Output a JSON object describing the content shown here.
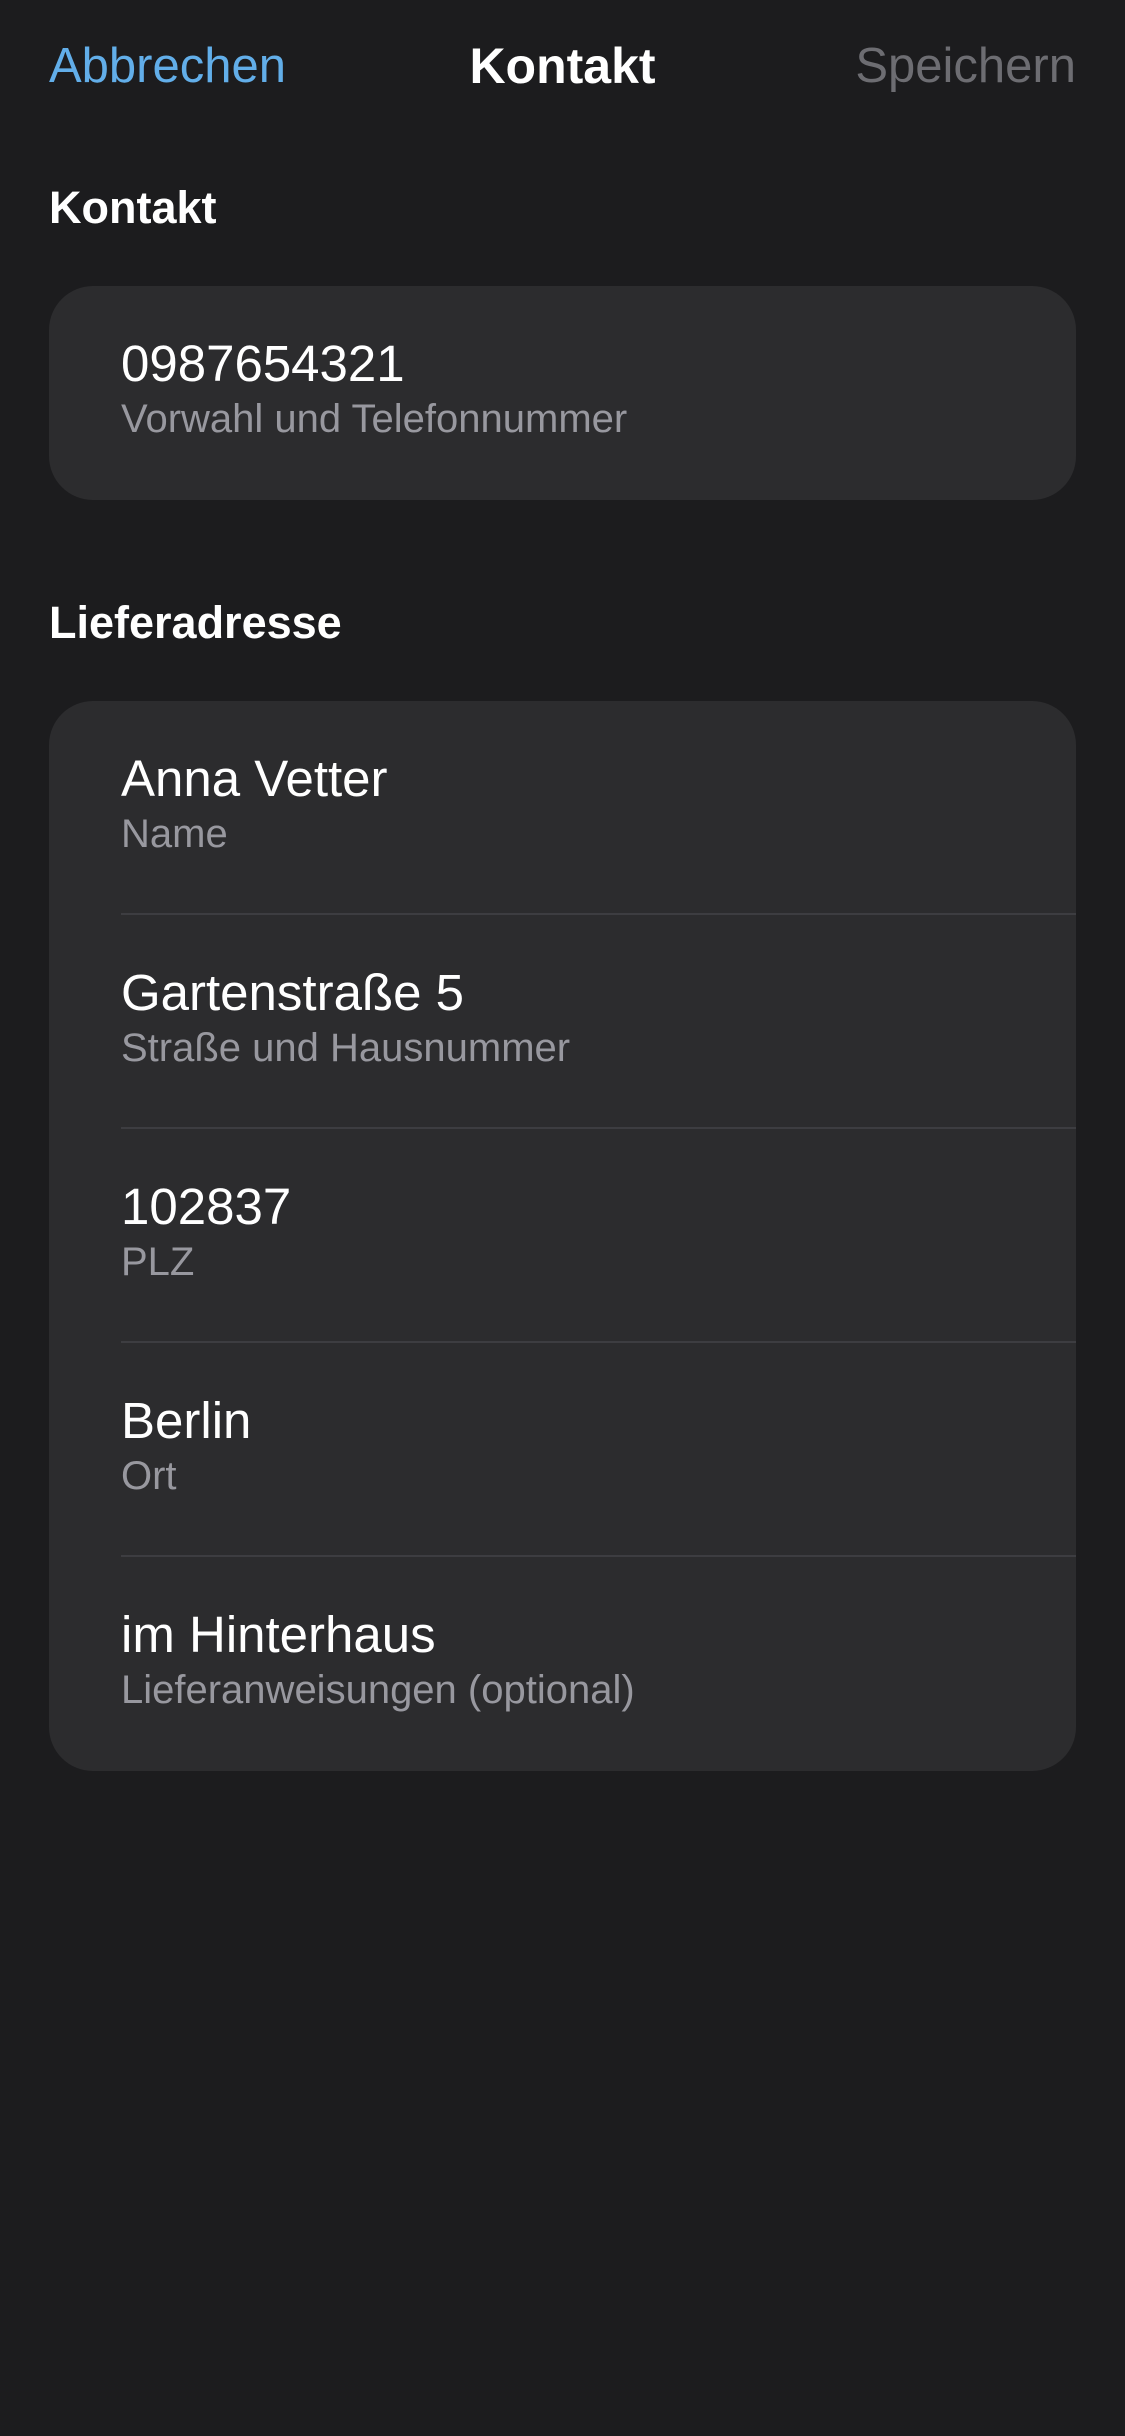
{
  "navbar": {
    "cancel_label": "Abbrechen",
    "title": "Kontakt",
    "save_label": "Speichern"
  },
  "contact_section": {
    "header": "Kontakt",
    "fields": [
      {
        "value": "0987654321",
        "label": "Vorwahl und Telefonnummer"
      }
    ]
  },
  "address_section": {
    "header": "Lieferadresse",
    "fields": [
      {
        "value": "Anna Vetter",
        "label": "Name"
      },
      {
        "value": "Gartenstraße 5",
        "label": "Straße und Hausnummer"
      },
      {
        "value": "102837",
        "label": "PLZ"
      },
      {
        "value": "Berlin",
        "label": "Ort"
      },
      {
        "value": "im Hinterhaus",
        "label": "Lieferanweisungen (optional)"
      }
    ]
  },
  "colors": {
    "background": "#1c1c1e",
    "card": "#2c2c2e",
    "accent": "#62aee9",
    "disabled": "#6d6d72",
    "secondary_text": "#98989f"
  }
}
